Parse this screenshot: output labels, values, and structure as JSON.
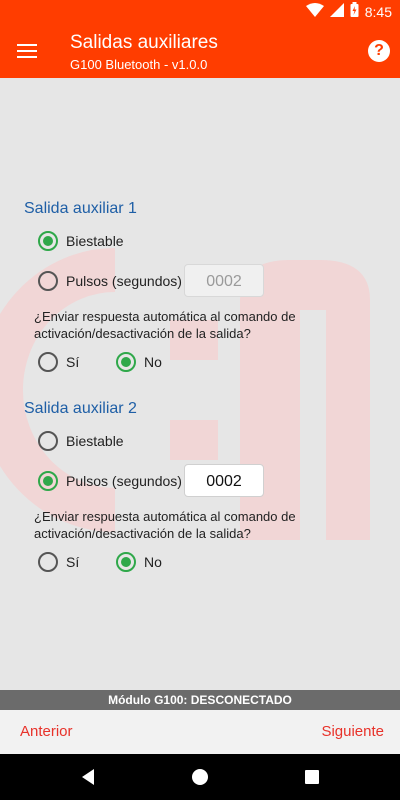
{
  "status_bar": {
    "time": "8:45",
    "icons": [
      "wifi-icon",
      "signal-icon",
      "battery-icon"
    ]
  },
  "app_bar": {
    "title": "Salidas auxiliares",
    "subtitle": "G100 Bluetooth - v1.0.0",
    "menu_icon": "menu-icon",
    "help_icon": "help-icon",
    "help_glyph": "?"
  },
  "colors": {
    "accent": "#ff3d00",
    "section_title": "#1f5fa6",
    "radio_selected": "#2fa84a",
    "nav_text": "#e8322a"
  },
  "outputs": [
    {
      "title": "Salida auxiliar 1",
      "mode_biestable": "Biestable",
      "mode_pulsos": "Pulsos (segundos)",
      "selected_mode": "Biestable",
      "pulse_value": "0002",
      "question_line1": "¿Enviar respuesta automática al comando de",
      "question_line2": "activación/desactivación de la salida?",
      "answer_yes": "Sí",
      "answer_no": "No",
      "selected_answer": "No"
    },
    {
      "title": "Salida auxiliar 2",
      "mode_biestable": "Biestable",
      "mode_pulsos": "Pulsos (segundos)",
      "selected_mode": "Pulsos (segundos)",
      "pulse_value": "0002",
      "question_line1": "¿Enviar respuesta automática al comando de",
      "question_line2": "activación/desactivación de la salida?",
      "answer_yes": "Sí",
      "answer_no": "No",
      "selected_answer": "No"
    }
  ],
  "connection_status": "Módulo G100: DESCONECTADO",
  "navigation": {
    "previous": "Anterior",
    "next": "Siguiente"
  },
  "system_nav": [
    "back-icon",
    "home-icon",
    "recents-icon"
  ]
}
